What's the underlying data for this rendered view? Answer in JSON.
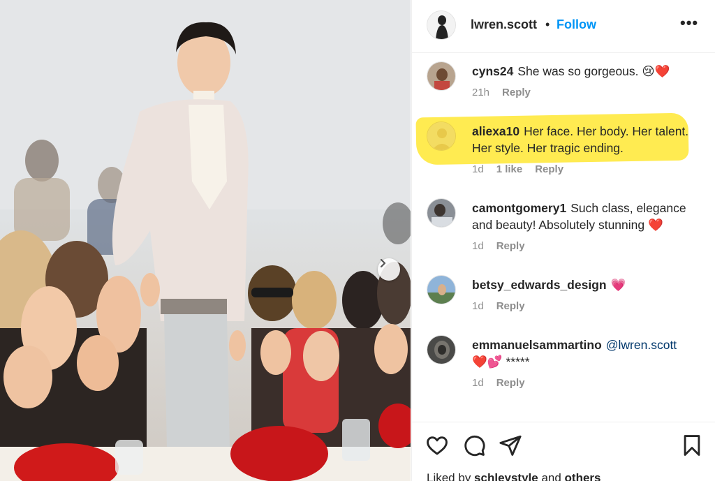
{
  "post": {
    "username": "lwren.scott",
    "separator": "•",
    "follow_label": "Follow",
    "more_icon": "more-options-icon",
    "more_label": "•••"
  },
  "carousel": {
    "next_icon": "chevron-right-icon"
  },
  "comments": [
    {
      "username": "cyns24",
      "text": "She was so gorgeous. ",
      "emoji": "😢",
      "heart": "❤️",
      "time": "21h",
      "reply": "Reply"
    },
    {
      "username": "aliexa10",
      "text": "Her face. Her body. Her talent. Her style. Her tragic ending.",
      "time": "1d",
      "likes": "1 like",
      "reply": "Reply",
      "highlight_color": "#ffe733"
    },
    {
      "username": "camontgomery1",
      "text": "Such class, elegance and beauty! Absolutely stunning ",
      "heart": "❤️",
      "time": "1d",
      "reply": "Reply"
    },
    {
      "username": "betsy_edwards_design",
      "heart": "💗",
      "time": "1d",
      "reply": "Reply"
    },
    {
      "username": "emmanuelsammartino",
      "mention": "@lwren.scott",
      "hearts": "❤️💕",
      "stars": "*****",
      "time": "1d",
      "reply": "Reply"
    }
  ],
  "actions": {
    "like_icon": "heart-outline-icon",
    "comment_icon": "comment-icon",
    "share_icon": "send-icon",
    "save_icon": "bookmark-icon"
  },
  "liked_by": {
    "prefix": "Liked by ",
    "user": "schleystyle",
    "middle": " and ",
    "others": "others"
  },
  "colors": {
    "link": "#0095f6",
    "highlight": "#ffe733",
    "heart": "#ed1c24",
    "text": "#262626",
    "meta": "#8e8e8e"
  }
}
